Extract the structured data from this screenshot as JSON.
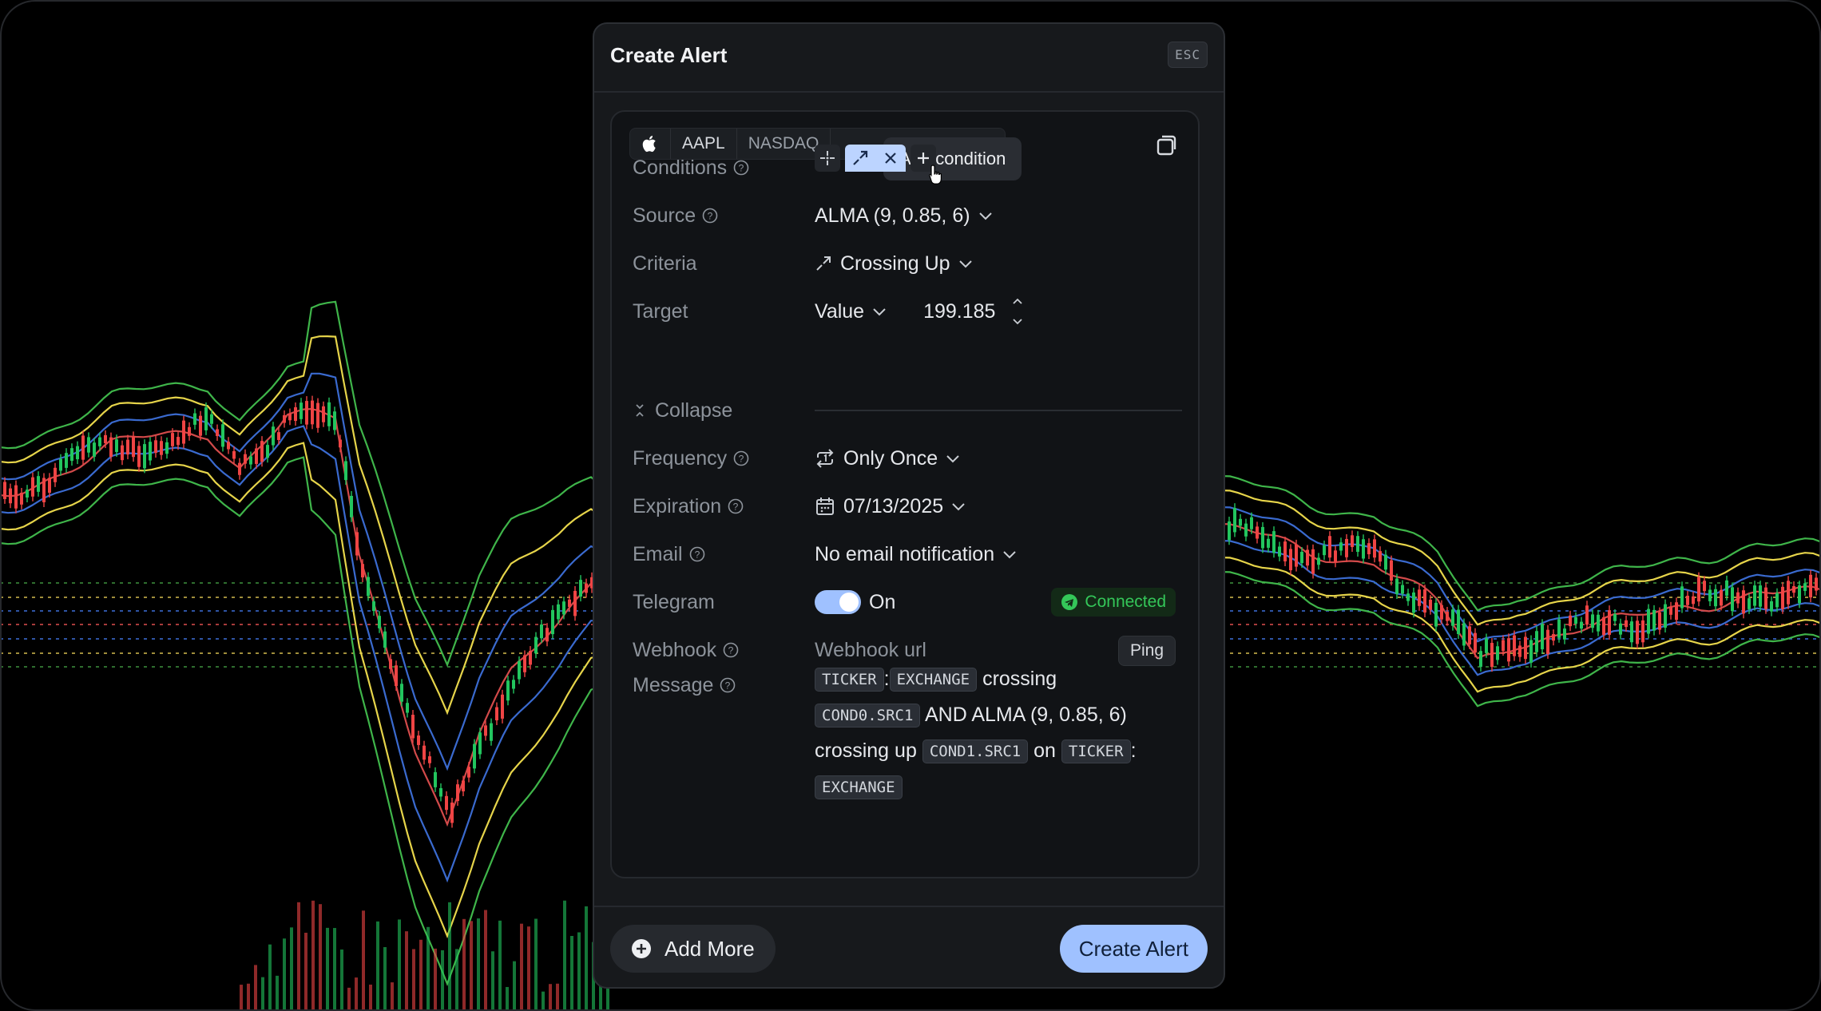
{
  "dialog": {
    "title": "Create Alert",
    "esc_label": "ESC"
  },
  "symbol": {
    "icon": "apple-logo-icon",
    "ticker": "AAPL",
    "exchange": "NASDAQ"
  },
  "tooltip": "Add condition",
  "form": {
    "conditions_label": "Conditions",
    "source_label": "Source",
    "source_value": "ALMA (9, 0.85, 6)",
    "criteria_label": "Criteria",
    "criteria_value": "Crossing Up",
    "target_label": "Target",
    "target_type": "Value",
    "target_value": "199.185",
    "collapse_label": "Collapse",
    "frequency_label": "Frequency",
    "frequency_value": "Only Once",
    "expiration_label": "Expiration",
    "expiration_value": "07/13/2025",
    "email_label": "Email",
    "email_value": "No email notification",
    "telegram_label": "Telegram",
    "telegram_toggle": "On",
    "telegram_status": "Connected",
    "webhook_label": "Webhook",
    "webhook_placeholder": "Webhook url",
    "ping_label": "Ping",
    "message_label": "Message"
  },
  "message": {
    "tok1": "TICKER",
    "sep1": ":",
    "tok2": "EXCHANGE",
    "t1": "crossing",
    "tok3": "COND0.SRC1",
    "t2": "AND ALMA (9, 0.85, 6)",
    "t3": "crossing up",
    "tok4": "COND1.SRC1",
    "t4": "on",
    "tok5": "TICKER",
    "sep2": ":",
    "tok6": "EXCHANGE"
  },
  "footer": {
    "add_more": "Add More",
    "create": "Create Alert"
  },
  "colors": {
    "accent": "#9fc1ff",
    "connected": "#34c759",
    "candle_up": "#22c55e",
    "candle_down": "#ef4444"
  }
}
